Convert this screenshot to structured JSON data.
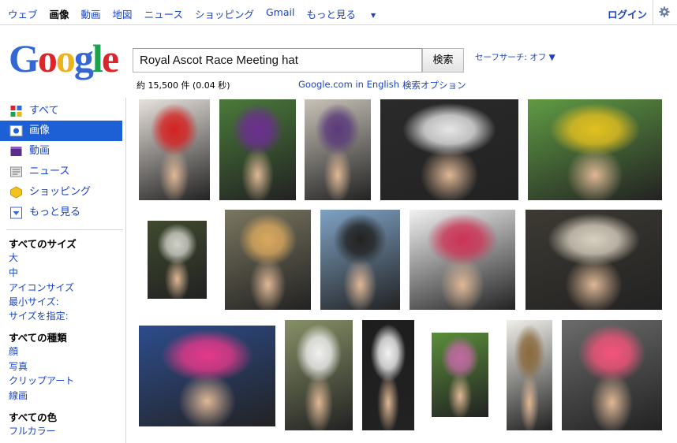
{
  "topbar": {
    "items": [
      "ウェブ",
      "画像",
      "動画",
      "地図",
      "ニュース",
      "ショッピング",
      "Gmail",
      "もっと見る"
    ],
    "more_caret": "▼",
    "login": "ログイン"
  },
  "logo": {
    "letters": [
      "G",
      "o",
      "o",
      "g",
      "l",
      "e"
    ]
  },
  "search": {
    "query": "Royal Ascot Race Meeting hat",
    "button": "検索",
    "safesearch": "セーフサーチ: オフ ▼"
  },
  "stats": {
    "results": "約 15,500 件 (0.04 秒)",
    "google_com": "Google.com in English",
    "advanced": "検索オプション"
  },
  "sidebar": {
    "nav": [
      {
        "label": "すべて",
        "icon": "all-icon"
      },
      {
        "label": "画像",
        "icon": "images-icon"
      },
      {
        "label": "動画",
        "icon": "video-icon"
      },
      {
        "label": "ニュース",
        "icon": "news-icon"
      },
      {
        "label": "ショッピング",
        "icon": "shopping-icon"
      },
      {
        "label": "もっと見る",
        "icon": "more-icon"
      }
    ],
    "size_heading": "すべてのサイズ",
    "sizes": [
      "大",
      "中",
      "アイコンサイズ",
      "最小サイズ:",
      "サイズを指定:"
    ],
    "type_heading": "すべての種類",
    "types": [
      "顔",
      "写真",
      "クリップアート",
      "線画"
    ],
    "color_heading": "すべての色",
    "colors": [
      "フルカラー"
    ]
  },
  "images": [
    {
      "name": "woman-red-dress-antler-hat",
      "bg": "#e8e2dc",
      "accent": "#d42222"
    },
    {
      "name": "women-purple-green-hat",
      "bg": "#4a7a3a",
      "accent": "#6b2f8f"
    },
    {
      "name": "woman-purple-feather-hat",
      "bg": "#c8c2b8",
      "accent": "#5b3a7a"
    },
    {
      "name": "white-feather-hats-closeup",
      "bg": "#2a2a2a",
      "accent": "#e6e6e6"
    },
    {
      "name": "ascot-racecourse-horses",
      "bg": "#5f9b44",
      "accent": "#e3c01f"
    },
    {
      "name": "woman-clock-hat",
      "bg": "#3f4a2e",
      "accent": "#cfd0c8"
    },
    {
      "name": "woman-ice-cream-hat",
      "bg": "#7a7660",
      "accent": "#d9a85e"
    },
    {
      "name": "boys-morning-suits",
      "bg": "#7fa2c4",
      "accent": "#222222"
    },
    {
      "name": "hat-collage",
      "bg": "#f2f2f2",
      "accent": "#cc3355"
    },
    {
      "name": "royal-carriage",
      "bg": "#3d3a33",
      "accent": "#d8cfbf"
    },
    {
      "name": "woman-drink-hat-union-jack",
      "bg": "#2d4c8c",
      "accent": "#e4398a"
    },
    {
      "name": "woman-white-dress-trees",
      "bg": "#869066",
      "accent": "#f0f0f0"
    },
    {
      "name": "mask-hat-woman",
      "bg": "#1d1d1d",
      "accent": "#f2f2f2"
    },
    {
      "name": "woman-black-hat-back",
      "bg": "#5a8e3a",
      "accent": "#c06aa2"
    },
    {
      "name": "cowboy-hats-men",
      "bg": "#f0efe9",
      "accent": "#8a6a3e"
    },
    {
      "name": "woman-pink-wide-hat",
      "bg": "#6b6b6b",
      "accent": "#f3547a"
    }
  ]
}
